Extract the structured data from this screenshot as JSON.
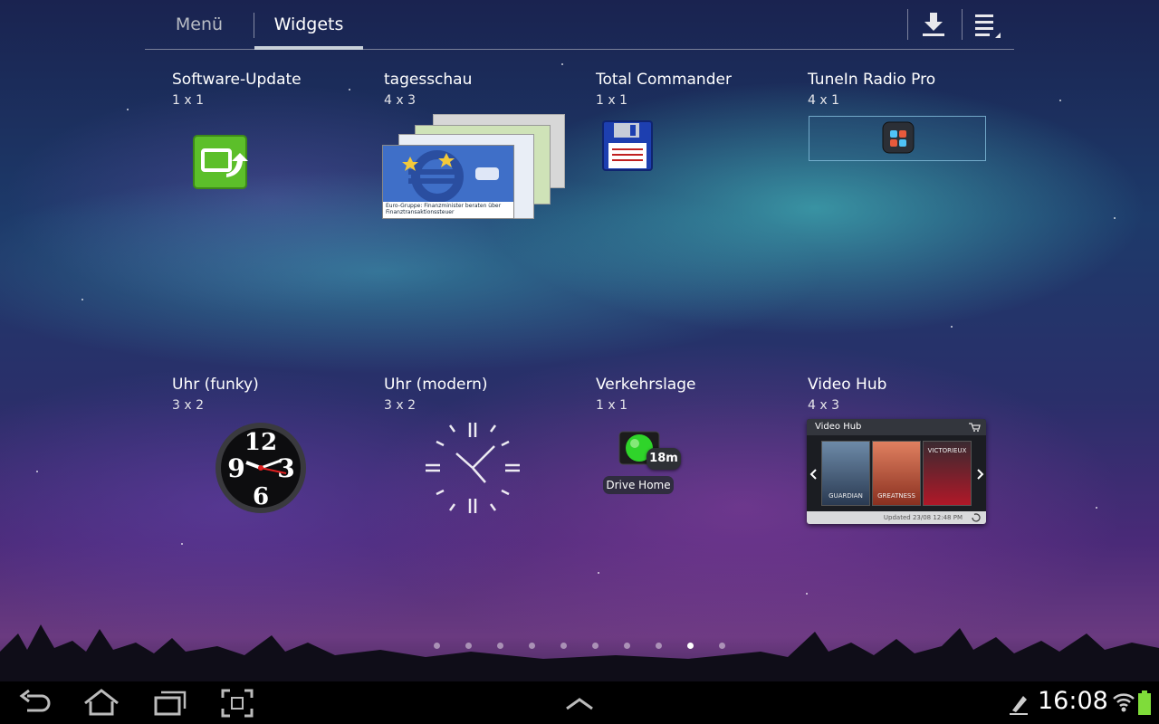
{
  "tabs": [
    {
      "label": "Menü",
      "active": false
    },
    {
      "label": "Widgets",
      "active": true
    }
  ],
  "toolbar_icons": [
    "download-icon",
    "overflow-menu-icon"
  ],
  "widgets": [
    {
      "name": "Software-Update",
      "size": "1 x 1",
      "icon": "software-update-icon"
    },
    {
      "name": "tagesschau",
      "size": "4 x 3",
      "caption": "Euro-Gruppe: Finanzminister beraten über Finanztransaktionssteuer"
    },
    {
      "name": "Total Commander",
      "size": "1 x 1",
      "icon": "floppy-disk-icon"
    },
    {
      "name": "TuneIn Radio Pro",
      "size": "4 x 1",
      "icon": "tunein-icon"
    },
    {
      "name": "Uhr (funky)",
      "size": "3 x 2",
      "icon": "funky-clock-icon"
    },
    {
      "name": "Uhr (modern)",
      "size": "3 x 2",
      "icon": "modern-clock-icon"
    },
    {
      "name": "Verkehrslage",
      "size": "1 x 1",
      "badge": "18m",
      "label": "Drive Home"
    },
    {
      "name": "Video Hub",
      "size": "4 x 3",
      "header": "Video Hub",
      "posters": [
        "GUARDIAN",
        "GREATNESS",
        "VICTORIEUX"
      ],
      "footer": "Updated 23/08 12:48 PM"
    }
  ],
  "page_indicator": {
    "count": 10,
    "active_index": 8
  },
  "status_bar": {
    "time": "16:08",
    "battery_color": "#7fdc3a"
  },
  "nav_icons": [
    "back-icon",
    "home-icon",
    "recent-apps-icon",
    "screenshot-icon",
    "up-chevron-icon"
  ],
  "colors": {
    "accent": "#c9d1da",
    "widget_green": "#5cbf2a"
  }
}
